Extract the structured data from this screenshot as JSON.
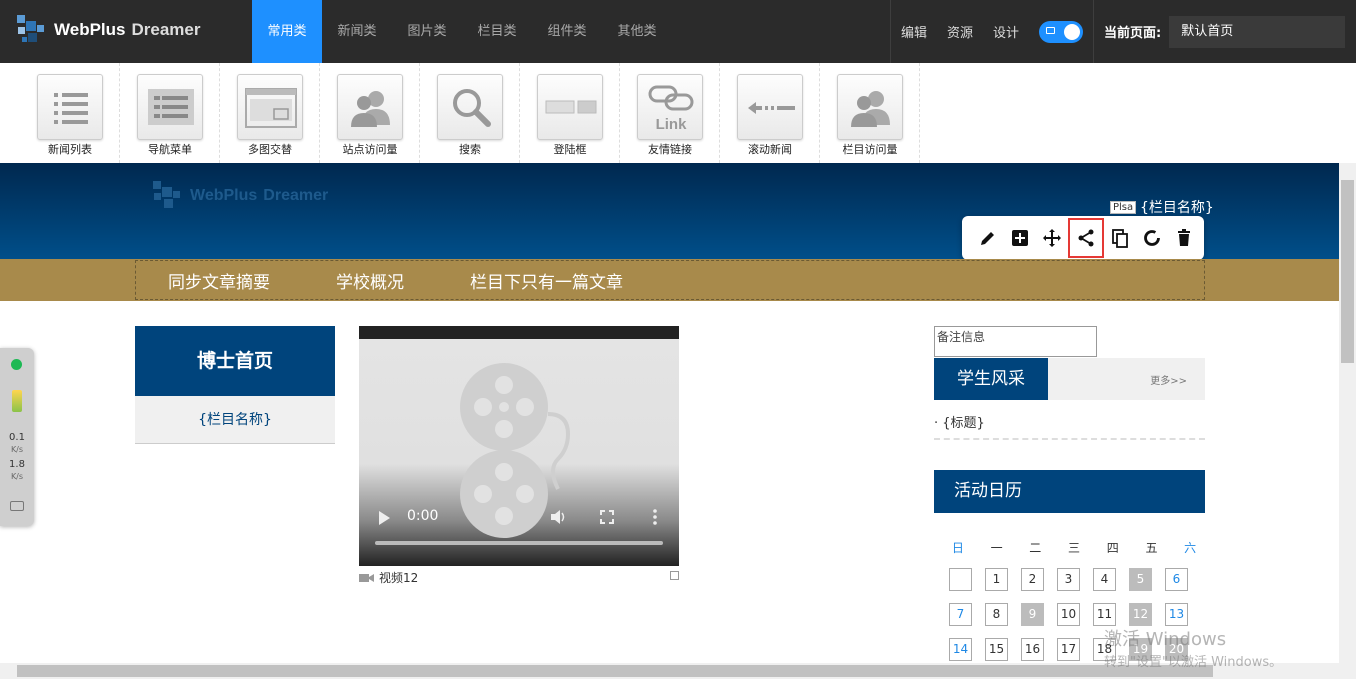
{
  "app": {
    "logo_name": "WebPlus",
    "logo_sub": "Dreamer"
  },
  "category_tabs": [
    {
      "label": "常用类",
      "active": true
    },
    {
      "label": "新闻类"
    },
    {
      "label": "图片类"
    },
    {
      "label": "栏目类"
    },
    {
      "label": "组件类"
    },
    {
      "label": "其他类"
    }
  ],
  "top_actions": {
    "edit": "编辑",
    "resources": "资源",
    "design": "设计",
    "current_page_label": "当前页面:",
    "current_page_value": "默认首页"
  },
  "widgets": [
    {
      "label": "新闻列表",
      "icon": "list-icon"
    },
    {
      "label": "导航菜单",
      "icon": "nav-menu-icon"
    },
    {
      "label": "多图交替",
      "icon": "slideshow-icon"
    },
    {
      "label": "站点访问量",
      "icon": "users-icon"
    },
    {
      "label": "搜索",
      "icon": "search-icon"
    },
    {
      "label": "登陆框",
      "icon": "login-box-icon"
    },
    {
      "label": "友情链接",
      "icon": "link-icon"
    },
    {
      "label": "滚动新闻",
      "icon": "scroll-news-icon"
    },
    {
      "label": "栏目访问量",
      "icon": "users-icon"
    }
  ],
  "preview": {
    "banner_logo_name": "WebPlus",
    "banner_logo_sub": "Dreamer",
    "banner_column": "{栏目名称}",
    "tooltip_tag": "Plsa",
    "toolbar_icons": [
      "pencil-icon",
      "add-icon",
      "move-icon",
      "share-icon",
      "copy-icon",
      "refresh-icon",
      "delete-icon"
    ],
    "nav_items": [
      "同步文章摘要",
      "学校概况",
      "栏目下只有一篇文章"
    ],
    "left_title": "博士首页",
    "left_sub": "{栏目名称}",
    "video_time": "0:00",
    "video_caption": "视频12",
    "note_placeholder": "备注信息",
    "section_title": "学生风采",
    "section_more": "更多>>",
    "news_item": "· {标题}",
    "calendar_title": "活动日历",
    "weekdays": [
      "日",
      "一",
      "二",
      "三",
      "四",
      "五",
      "六"
    ],
    "calendar_rows": [
      [
        "",
        "1",
        "2",
        "3",
        "4",
        "5",
        "6"
      ],
      [
        "7",
        "8",
        "9",
        "10",
        "11",
        "12",
        "13"
      ],
      [
        "14",
        "15",
        "16",
        "17",
        "18",
        "19",
        "20"
      ]
    ]
  },
  "float_panel": {
    "up_value": "0.1",
    "up_unit": "K/s",
    "down_value": "1.8",
    "down_unit": "K/s"
  },
  "watermark": {
    "line1": "激活 Windows",
    "line2": "转到\"设置\"以激活 Windows。"
  },
  "colors": {
    "accent": "#1e90ff",
    "brand_blue": "#00447c",
    "nav_gold": "#a88a4b",
    "toolbar_highlight": "#e53935"
  }
}
